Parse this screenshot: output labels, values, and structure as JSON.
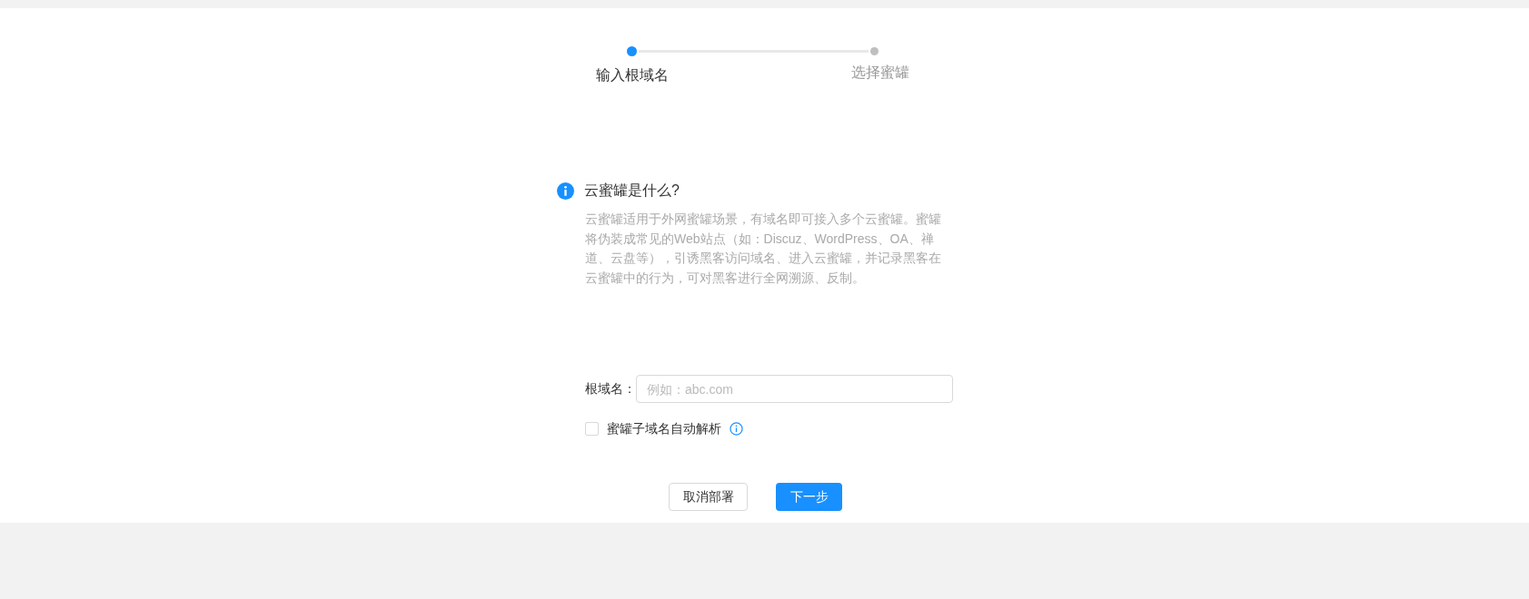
{
  "steps": [
    {
      "label": "输入根域名",
      "selected": true
    },
    {
      "label": "选择蜜罐",
      "selected": false
    }
  ],
  "info": {
    "title": "云蜜罐是什么?",
    "text": "云蜜罐适用于外网蜜罐场景，有域名即可接入多个云蜜罐。蜜罐将伪装成常见的Web站点（如：Discuz、WordPress、OA、禅道、云盘等），引诱黑客访问域名、进入云蜜罐，并记录黑客在云蜜罐中的行为，可对黑客进行全网溯源、反制。"
  },
  "form": {
    "label": "根域名：",
    "placeholder": "例如：abc.com",
    "checkbox": {
      "label": "蜜罐子域名自动解析",
      "checked": false
    }
  },
  "buttons": [
    {
      "label": "取消部署",
      "kind": "default"
    },
    {
      "label": "下一步",
      "kind": "primary"
    }
  ]
}
